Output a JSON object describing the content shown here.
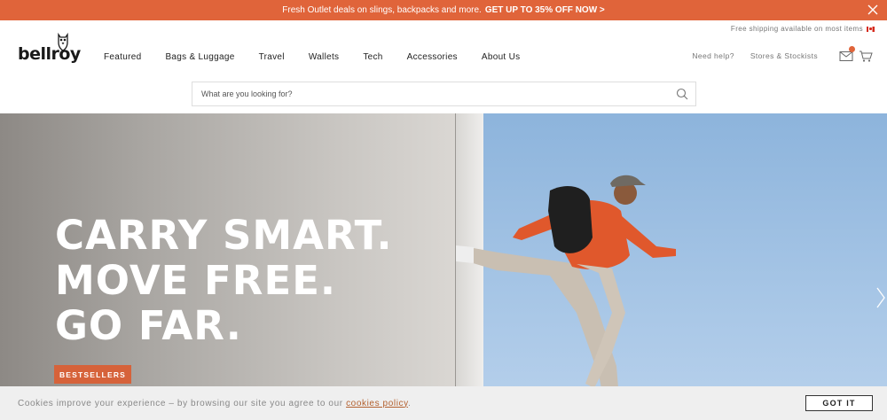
{
  "promo": {
    "text": "Fresh Outlet deals on slings, backpacks and more.",
    "cta": "GET UP TO 35% OFF NOW >",
    "close_icon": "close-icon"
  },
  "header": {
    "shipping_note": "Free shipping available on most items",
    "flag_icon": "canada-flag-icon",
    "logo_text": "bellroy",
    "logo_icon": "owl-icon",
    "nav": [
      {
        "label": "Featured"
      },
      {
        "label": "Bags & Luggage"
      },
      {
        "label": "Travel"
      },
      {
        "label": "Wallets"
      },
      {
        "label": "Tech"
      },
      {
        "label": "Accessories"
      },
      {
        "label": "About Us"
      }
    ],
    "util": {
      "help": "Need help?",
      "stores": "Stores & Stockists",
      "message_icon": "envelope-icon",
      "cart_icon": "cart-icon"
    }
  },
  "search": {
    "placeholder": "What are you looking for?",
    "value": "",
    "icon": "search-icon"
  },
  "hero": {
    "headline": [
      "CARRY SMART.",
      "MOVE FREE.",
      "GO FAR."
    ],
    "cta": "BESTSELLERS",
    "next_icon": "chevron-right-icon"
  },
  "cookie": {
    "text": "Cookies improve your experience – by browsing our site you agree to our",
    "link": "cookies policy",
    "suffix": ".",
    "button": "GOT IT"
  },
  "colors": {
    "accent": "#e0643a",
    "cta": "#d6623a",
    "sky": "#a7c6e6"
  }
}
